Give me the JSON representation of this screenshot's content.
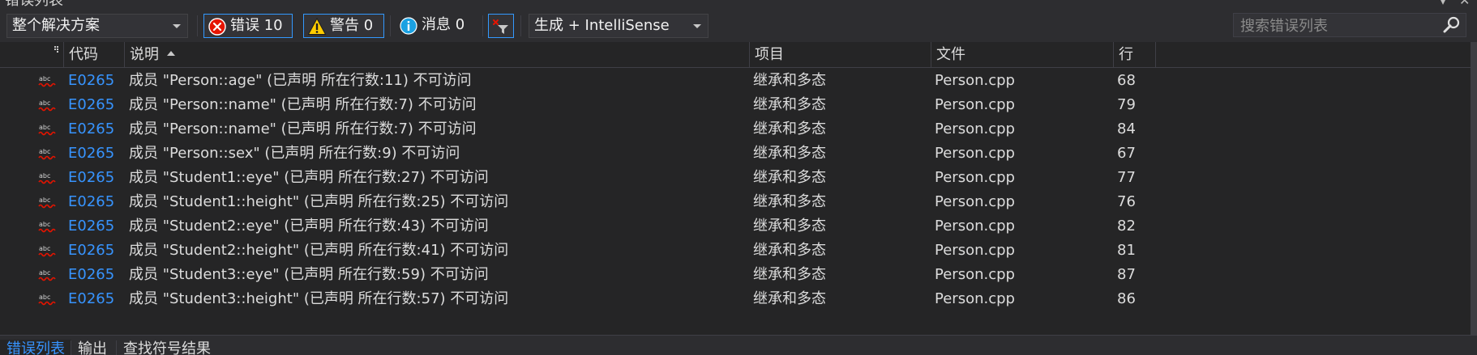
{
  "window": {
    "title": "错误列表"
  },
  "toolbar": {
    "scope_selected": "整个解决方案",
    "errors_label": "错误 10",
    "warnings_label": "警告 0",
    "messages_label": "消息 0",
    "build_filter_selected": "生成 + IntelliSense",
    "search_placeholder": "搜索错误列表"
  },
  "columns": {
    "code": "代码",
    "description": "说明",
    "project": "项目",
    "file": "文件",
    "line": "行"
  },
  "rows": [
    {
      "code": "E0265",
      "description": "成员 \"Person::age\" (已声明 所在行数:11) 不可访问",
      "project": "继承和多态",
      "file": "Person.cpp",
      "line": "68"
    },
    {
      "code": "E0265",
      "description": "成员 \"Person::name\" (已声明 所在行数:7) 不可访问",
      "project": "继承和多态",
      "file": "Person.cpp",
      "line": "79"
    },
    {
      "code": "E0265",
      "description": "成员 \"Person::name\" (已声明 所在行数:7) 不可访问",
      "project": "继承和多态",
      "file": "Person.cpp",
      "line": "84"
    },
    {
      "code": "E0265",
      "description": "成员 \"Person::sex\" (已声明 所在行数:9) 不可访问",
      "project": "继承和多态",
      "file": "Person.cpp",
      "line": "67"
    },
    {
      "code": "E0265",
      "description": "成员 \"Student1::eye\" (已声明 所在行数:27) 不可访问",
      "project": "继承和多态",
      "file": "Person.cpp",
      "line": "77"
    },
    {
      "code": "E0265",
      "description": "成员 \"Student1::height\" (已声明 所在行数:25) 不可访问",
      "project": "继承和多态",
      "file": "Person.cpp",
      "line": "76"
    },
    {
      "code": "E0265",
      "description": "成员 \"Student2::eye\" (已声明 所在行数:43) 不可访问",
      "project": "继承和多态",
      "file": "Person.cpp",
      "line": "82"
    },
    {
      "code": "E0265",
      "description": "成员 \"Student2::height\" (已声明 所在行数:41) 不可访问",
      "project": "继承和多态",
      "file": "Person.cpp",
      "line": "81"
    },
    {
      "code": "E0265",
      "description": "成员 \"Student3::eye\" (已声明 所在行数:59) 不可访问",
      "project": "继承和多态",
      "file": "Person.cpp",
      "line": "87"
    },
    {
      "code": "E0265",
      "description": "成员 \"Student3::height\" (已声明 所在行数:57) 不可访问",
      "project": "继承和多态",
      "file": "Person.cpp",
      "line": "86"
    }
  ],
  "tabs": [
    {
      "label": "错误列表",
      "active": true
    },
    {
      "label": "输出",
      "active": false
    },
    {
      "label": "查找符号结果",
      "active": false
    }
  ],
  "icons": {
    "row_icon": "intellisense-squiggle-icon",
    "error_icon": "error-circle-icon",
    "warning_icon": "warning-triangle-icon",
    "message_icon": "info-circle-icon",
    "filter_icon": "filter-clear-icon",
    "search_icon": "search-icon",
    "column_options_icon": "column-options-icon"
  },
  "colors": {
    "background": "#252526",
    "toolbar": "#2d2d30",
    "accent_blue": "#3794ff",
    "error_red": "#e51400",
    "warning_yellow": "#ffcc00",
    "info_blue": "#1ba1e2"
  }
}
